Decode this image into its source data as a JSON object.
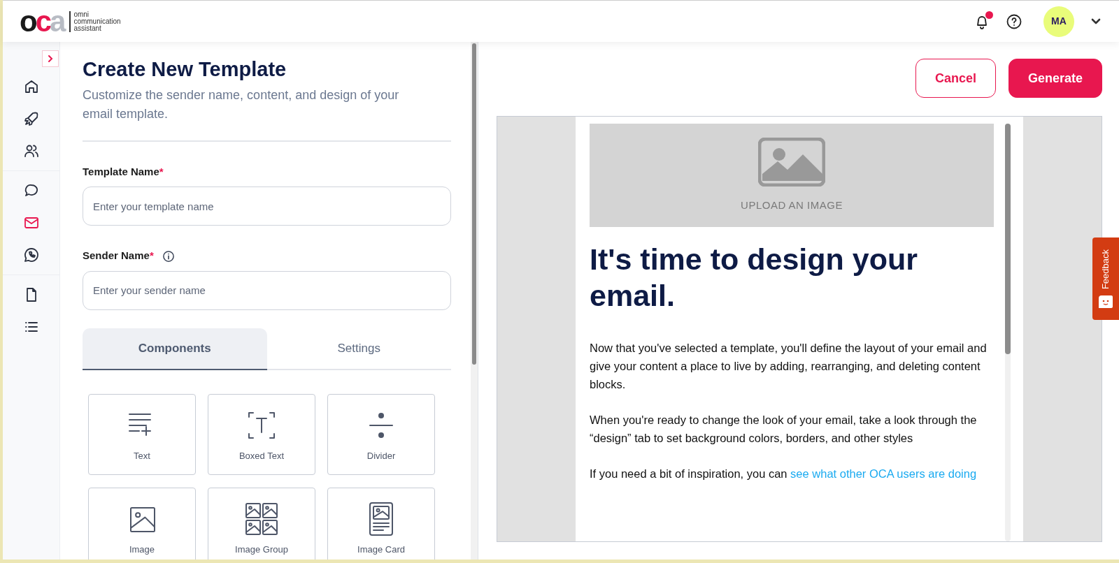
{
  "header": {
    "logo": {
      "mark": [
        "o",
        "c",
        "a"
      ],
      "tagline": [
        "omni",
        "communication",
        "assistant"
      ]
    },
    "notifications": {
      "unread": true
    },
    "avatar": {
      "initials": "MA"
    }
  },
  "sidebar": {
    "items": [
      [
        {
          "kind": "home",
          "selected": false
        },
        {
          "kind": "rocket",
          "selected": false
        },
        {
          "kind": "users",
          "selected": false
        }
      ],
      [
        {
          "kind": "chat",
          "selected": false
        },
        {
          "kind": "mail",
          "selected": true
        },
        {
          "kind": "whatsapp",
          "selected": false
        }
      ],
      [
        {
          "kind": "document",
          "selected": false
        },
        {
          "kind": "list",
          "selected": false
        }
      ]
    ]
  },
  "form": {
    "title": "Create New Template",
    "subtitle": "Customize the sender name, content, and design of your email template.",
    "fields": [
      {
        "label": "Template Name",
        "required_mark": "*",
        "info": false,
        "placeholder": "Enter your template name"
      },
      {
        "label": "Sender Name",
        "required_mark": "*",
        "info": true,
        "placeholder": "Enter your sender name"
      }
    ],
    "tabs": [
      {
        "label": "Components",
        "selected": true
      },
      {
        "label": "Settings",
        "selected": false
      }
    ],
    "components": [
      {
        "kind": "text",
        "label": "Text"
      },
      {
        "kind": "boxed-text",
        "label": "Boxed Text"
      },
      {
        "kind": "divider",
        "label": "Divider"
      },
      {
        "kind": "image",
        "label": "Image"
      },
      {
        "kind": "image-group",
        "label": "Image Group"
      },
      {
        "kind": "image-card",
        "label": "Image Card"
      }
    ]
  },
  "actions": [
    {
      "kind": "outline",
      "label": "Cancel"
    },
    {
      "kind": "primary",
      "label": "Generate"
    }
  ],
  "preview": {
    "upload_label": "UPLOAD AN IMAGE",
    "heading": "It's time to design your email.",
    "paragraphs": [
      {
        "text": "Now that you've selected a template, you'll define the layout of your email and give your content a place to live by adding, rearranging, and deleting content blocks."
      },
      {
        "text": "When you're ready to change the look of your email, take a look through the “design” tab to set background colors, borders, and other styles"
      },
      {
        "text": "If you need a bit of inspiration, you can",
        "link": "see what other OCA users are doing"
      }
    ]
  },
  "feedback": {
    "label": "Feedback"
  }
}
